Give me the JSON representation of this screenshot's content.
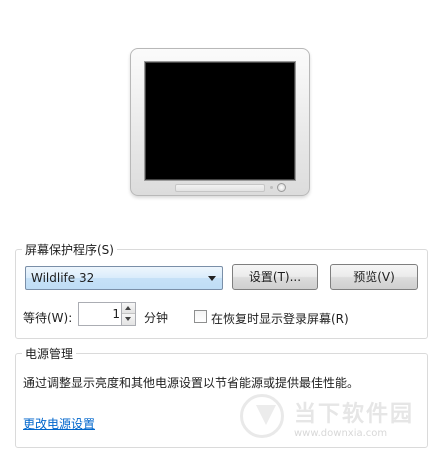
{
  "screensaver": {
    "group_title": "屏幕保护程序(S)",
    "selected": "Wildlife 32",
    "settings_label": "设置(T)...",
    "preview_label": "预览(V)",
    "wait_label": "等待(W):",
    "wait_value": "1",
    "minutes_label": "分钟",
    "resume_checkbox_label": "在恢复时显示登录屏幕(R)",
    "resume_checked": false
  },
  "power": {
    "group_title": "电源管理",
    "description": "通过调整显示亮度和其他电源设置以节省能源或提供最佳性能。",
    "link_label": "更改电源设置"
  },
  "watermark": {
    "name": "当下软件园",
    "url": "www.downxia.com"
  },
  "icons": [
    "monitor-preview-icon",
    "chevron-down-icon",
    "spin-up-icon",
    "spin-down-icon"
  ]
}
